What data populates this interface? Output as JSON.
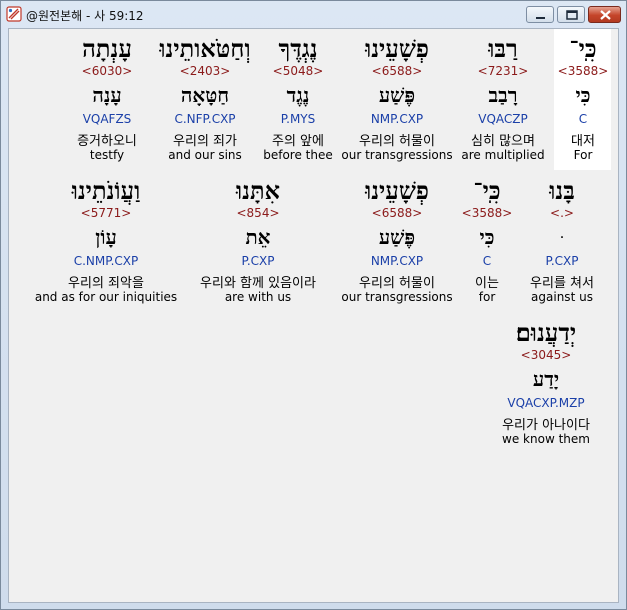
{
  "window": {
    "title": "@원전본해 - 사 59:12",
    "icon": "bible-app-icon",
    "controls": [
      "minimize-icon",
      "maximize-icon",
      "close-icon"
    ]
  },
  "words": [
    {
      "hebrew": "כִּֽי־",
      "strong": "<3588>",
      "morph": "C",
      "lemma": "כִּי",
      "korean": "대저",
      "english": "For"
    },
    {
      "hebrew": "רַבּוּ",
      "strong": "<7231>",
      "morph": "VQACZP",
      "lemma": "רָבַב",
      "korean": "심히 많으며",
      "english": "are multiplied"
    },
    {
      "hebrew": "פְשָׁעֵינוּ",
      "strong": "<6588>",
      "morph": "NMP.CXP",
      "lemma": "פֶּשַׁע",
      "korean": "우리의 허물이",
      "english": "our transgressions"
    },
    {
      "hebrew": "נֶגְדֶּךָ",
      "strong": "<5048>",
      "morph": "P.MYS",
      "lemma": "נֶגֶד",
      "korean": "주의 앞에",
      "english": "before thee"
    },
    {
      "hebrew": "וְחַטֹּאותֵינוּ",
      "strong": "<2403>",
      "morph": "C.NFP.CXP",
      "lemma": "חַטָּאָה",
      "korean": "우리의 죄가",
      "english": "and our sins"
    },
    {
      "hebrew": "עָנְתָה",
      "strong": "<6030>",
      "morph": "VQAFZS",
      "lemma": "עָנָה",
      "korean": "증거하오니",
      "english": "testfy"
    },
    {
      "hebrew": "בָּנוּ",
      "strong": "<.>",
      "morph": "P.CXP",
      "lemma": "ּ",
      "korean": "우리를 쳐서",
      "english": "against us"
    },
    {
      "hebrew": "כִּֽי־",
      "strong": "<3588>",
      "morph": "C",
      "lemma": "כִּי",
      "korean": "이는",
      "english": "for"
    },
    {
      "hebrew": "פְשָׁעֵינוּ",
      "strong": "<6588>",
      "morph": "NMP.CXP",
      "lemma": "פֶּשַׁע",
      "korean": "우리의 허물이",
      "english": "our transgressions"
    },
    {
      "hebrew": "אִתָּנוּ",
      "strong": "<854>",
      "morph": "P.CXP",
      "lemma": "אֵת",
      "korean": "우리와 함께 있음이라",
      "english": "are with us"
    },
    {
      "hebrew": "וַעֲוֹנֹתֵינוּ",
      "strong": "<5771>",
      "morph": "C.NMP.CXP",
      "lemma": "עָוֹן",
      "korean": "우리의 죄악을",
      "english": "and as for our iniquities"
    },
    {
      "hebrew": "יְדַעֲנוּם׃",
      "strong": "<3045>",
      "morph": "VQACXP.MZP",
      "lemma": "יָדַע",
      "korean": "우리가 아나이다",
      "english": "we know them"
    }
  ]
}
